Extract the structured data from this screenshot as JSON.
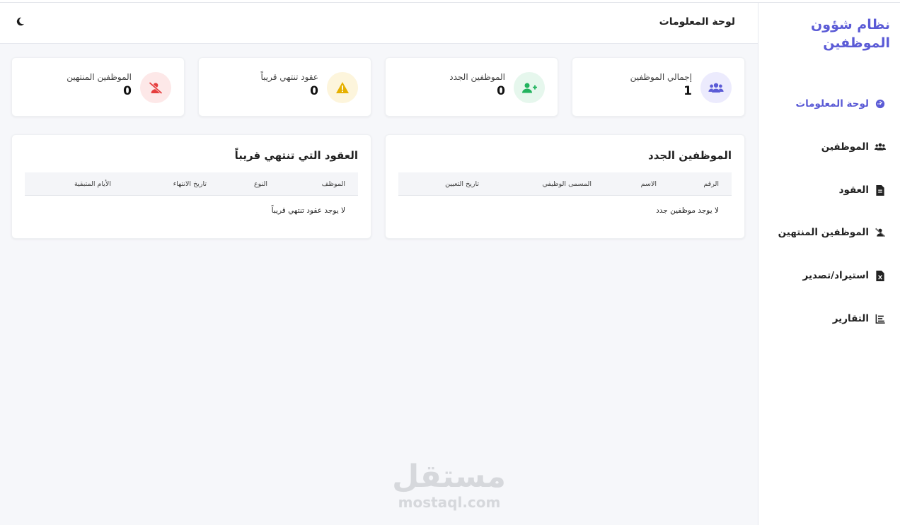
{
  "sidebar": {
    "brand": "نظام شؤون الموظفين",
    "items": [
      {
        "label": "لوحة المعلومات",
        "icon": "dashboard-icon",
        "active": true
      },
      {
        "label": "الموظفين",
        "icon": "users-icon",
        "active": false
      },
      {
        "label": "العقود",
        "icon": "contract-file-icon",
        "active": false
      },
      {
        "label": "الموظفين المنتهين",
        "icon": "user-slash-icon",
        "active": false
      },
      {
        "label": "استيراد/تصدير",
        "icon": "excel-file-icon",
        "active": false
      },
      {
        "label": "التقارير",
        "icon": "chart-icon",
        "active": false
      }
    ]
  },
  "header": {
    "title": "لوحة المعلومات",
    "theme_icon": "moon-icon"
  },
  "stats": [
    {
      "label": "إجمالي الموظفين",
      "value": "1",
      "icon": "users-icon",
      "color": "#5b5bd6",
      "bg": "#ecebfd"
    },
    {
      "label": "الموظفين الجدد",
      "value": "0",
      "icon": "user-plus-icon",
      "color": "#22b35e",
      "bg": "#e6f7ed"
    },
    {
      "label": "عقود تنتهي قريباً",
      "value": "0",
      "icon": "warning-icon",
      "color": "#e6b000",
      "bg": "#fdf5dc"
    },
    {
      "label": "الموظفين المنتهين",
      "value": "0",
      "icon": "user-slash-icon",
      "color": "#e53e3e",
      "bg": "#fde8e8"
    }
  ],
  "new_employees": {
    "title": "الموظفين الجدد",
    "columns": [
      "الرقم",
      "الاسم",
      "المسمى الوظيفي",
      "تاريخ التعيين"
    ],
    "empty": "لا يوجد موظفين جدد"
  },
  "expiring_contracts": {
    "title": "العقود التي تنتهي قريباً",
    "columns": [
      "الموظف",
      "النوع",
      "تاريخ الانتهاء",
      "الأيام المتبقية"
    ],
    "empty": "لا يوجد عقود تنتهي قريباً"
  },
  "watermark": {
    "arabic": "مستقل",
    "latin": "mostaql.com"
  }
}
